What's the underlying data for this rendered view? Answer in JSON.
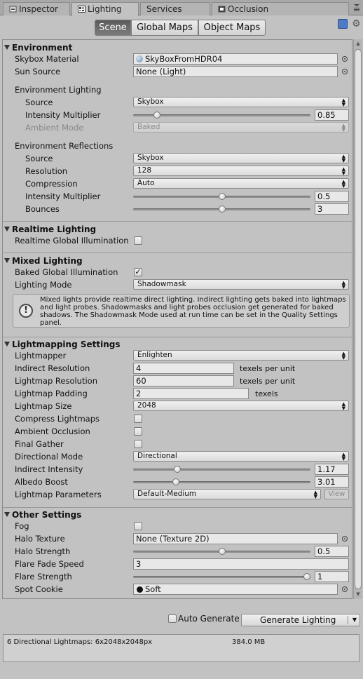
{
  "tabs": [
    {
      "label": "Inspector",
      "icon": "info-icon"
    },
    {
      "label": "Lighting",
      "icon": "lighting-icon"
    },
    {
      "label": "Services",
      "icon": ""
    },
    {
      "label": "Occlusion",
      "icon": "occlusion-icon"
    }
  ],
  "toolbar": {
    "scene": "Scene",
    "global_maps": "Global Maps",
    "object_maps": "Object Maps"
  },
  "environment": {
    "title": "Environment",
    "skybox_material_label": "Skybox Material",
    "skybox_material_value": "SkyBoxFromHDR04",
    "sun_source_label": "Sun Source",
    "sun_source_value": "None (Light)",
    "lighting_header": "Environment Lighting",
    "source_label": "Source",
    "source_value": "Skybox",
    "intensity_label": "Intensity Multiplier",
    "intensity_value": "0.85",
    "intensity_slider": 0.12,
    "ambient_mode_label": "Ambient Mode",
    "ambient_mode_value": "Baked",
    "reflections_header": "Environment Reflections",
    "refl_source_label": "Source",
    "refl_source_value": "Skybox",
    "resolution_label": "Resolution",
    "resolution_value": "128",
    "compression_label": "Compression",
    "compression_value": "Auto",
    "refl_intensity_label": "Intensity Multiplier",
    "refl_intensity_value": "0.5",
    "refl_intensity_slider": 0.5,
    "bounces_label": "Bounces",
    "bounces_value": "3",
    "bounces_slider": 0.5
  },
  "realtime": {
    "title": "Realtime Lighting",
    "rgi_label": "Realtime Global Illumination",
    "rgi_checked": false
  },
  "mixed": {
    "title": "Mixed Lighting",
    "bgi_label": "Baked Global Illumination",
    "bgi_checked": true,
    "mode_label": "Lighting Mode",
    "mode_value": "Shadowmask",
    "help_text": "Mixed lights provide realtime direct lighting. Indirect lighting gets baked into lightmaps and light probes. Shadowmasks and light probes occlusion get generated for baked shadows. The Shadowmask Mode used at run time can be set in the Quality Settings panel."
  },
  "lightmapping": {
    "title": "Lightmapping Settings",
    "lightmapper_label": "Lightmapper",
    "lightmapper_value": "Enlighten",
    "indirect_res_label": "Indirect Resolution",
    "indirect_res_value": "4",
    "texels_per_unit": "texels per unit",
    "lightmap_res_label": "Lightmap Resolution",
    "lightmap_res_value": "60",
    "padding_label": "Lightmap Padding",
    "padding_value": "2",
    "texels": "texels",
    "size_label": "Lightmap Size",
    "size_value": "2048",
    "compress_label": "Compress Lightmaps",
    "compress_checked": false,
    "ao_label": "Ambient Occlusion",
    "ao_checked": false,
    "final_gather_label": "Final Gather",
    "final_gather_checked": false,
    "directional_label": "Directional Mode",
    "directional_value": "Directional",
    "indirect_intensity_label": "Indirect Intensity",
    "indirect_intensity_value": "1.17",
    "indirect_intensity_slider": 0.24,
    "albedo_label": "Albedo Boost",
    "albedo_value": "3.01",
    "albedo_slider": 0.23,
    "params_label": "Lightmap Parameters",
    "params_value": "Default-Medium",
    "view_label": "View"
  },
  "other": {
    "title": "Other Settings",
    "fog_label": "Fog",
    "fog_checked": false,
    "halo_texture_label": "Halo Texture",
    "halo_texture_value": "None (Texture 2D)",
    "halo_strength_label": "Halo Strength",
    "halo_strength_value": "0.5",
    "halo_strength_slider": 0.5,
    "flare_fade_label": "Flare Fade Speed",
    "flare_fade_value": "3",
    "flare_strength_label": "Flare Strength",
    "flare_strength_value": "1",
    "flare_strength_slider": 1.0,
    "spot_cookie_label": "Spot Cookie",
    "spot_cookie_value": "Soft"
  },
  "bottom": {
    "auto_generate_label": "Auto Generate",
    "auto_generate_checked": false,
    "generate_label": "Generate Lighting",
    "lightmaps_info": "6 Directional Lightmaps: 6x2048x2048px",
    "lightmaps_size": "384.0 MB"
  }
}
